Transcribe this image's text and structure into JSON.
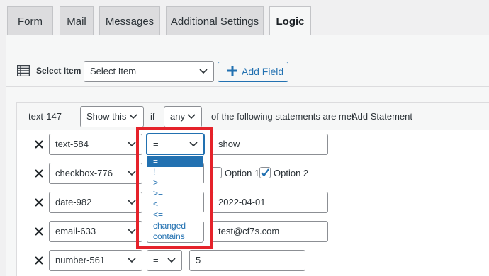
{
  "tabs": [
    {
      "label": "Form",
      "active": false
    },
    {
      "label": "Mail",
      "active": false
    },
    {
      "label": "Messages",
      "active": false
    },
    {
      "label": "Additional Settings",
      "active": false
    },
    {
      "label": "Logic",
      "active": true
    }
  ],
  "toolbar": {
    "select_item_label": "Select Item",
    "select_item_value": "Select Item",
    "add_field_label": "Add Field"
  },
  "logic": {
    "field_name": "text-147",
    "show_value": "Show this",
    "if_label": "if",
    "any_value": "any",
    "statement_text": "of the following statements are met",
    "add_statement_label": "Add Statement",
    "rows": [
      {
        "field": "text-584",
        "operator": "=",
        "value": "show"
      },
      {
        "field": "checkbox-776",
        "operator": "=",
        "option1": "Option 1",
        "option2": "Option 2",
        "option1_checked": false,
        "option2_checked": true
      },
      {
        "field": "date-982",
        "operator": "=",
        "value": "2022-04-01"
      },
      {
        "field": "email-633",
        "operator": "=",
        "value": "test@cf7s.com"
      },
      {
        "field": "number-561",
        "operator": "=",
        "value": "5"
      }
    ]
  },
  "operator_dropdown": {
    "selected": "=",
    "options": [
      "=",
      "!=",
      ">",
      ">=",
      "<",
      "<=",
      "changed",
      "contains"
    ]
  },
  "colors": {
    "accent": "#2271b1",
    "highlight": "#e5222a"
  }
}
